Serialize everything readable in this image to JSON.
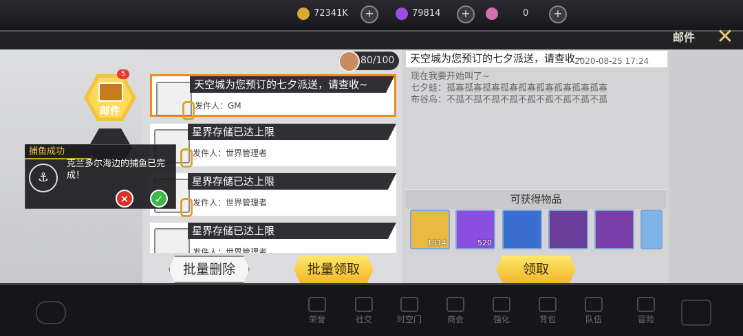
{
  "top_hud": {
    "gold": "72341K",
    "crystal": "79814",
    "gem": "0"
  },
  "header": {
    "title": "邮件",
    "close_icon": "close-x-icon"
  },
  "tabs": [
    {
      "label": "邮件",
      "badge": "5",
      "icon": "envelope-icon"
    },
    {
      "label": "",
      "icon": "chat-icon"
    }
  ],
  "mailbox": {
    "count": "80/100"
  },
  "mails": [
    {
      "title": "天空城为您预订的七夕派送，请查收~",
      "sender": "发件人：GM"
    },
    {
      "title": "星界存储已达上限",
      "sender": "发件人：世界管理者"
    },
    {
      "title": "星界存储已达上限",
      "sender": "发件人：世界管理者"
    },
    {
      "title": "星界存储已达上限",
      "sender": "发件人：世界管理者"
    }
  ],
  "buttons": {
    "batch_delete": "批量删除",
    "batch_claim": "批量领取",
    "claim": "领取"
  },
  "detail": {
    "title": "天空城为您预订的七夕派送，请查收~",
    "date": "2020-08-25 17:24",
    "lines": [
      "现在我要开始叫了~",
      "七夕蛙：孤寡孤寡孤寡孤寡孤寡孤寡孤寡孤寡孤寡",
      "布谷鸟：不孤不孤不孤不孤不孤不孤不孤不孤不孤"
    ]
  },
  "rewards": {
    "title": "可获得物品",
    "items": [
      {
        "icon": "gold-coin-icon",
        "count": "1314",
        "color": "#e8b942"
      },
      {
        "icon": "purple-crystal-icon",
        "count": "520",
        "color": "#8a4fe0"
      },
      {
        "icon": "slime-card-icon",
        "count": "",
        "color": "#3a6fd0"
      },
      {
        "icon": "character-card-icon",
        "count": "",
        "color": "#6b3c9a"
      },
      {
        "icon": "character-card-icon",
        "count": "",
        "color": "#7a3ea8"
      },
      {
        "icon": "card-icon",
        "count": "",
        "color": "#7fb4e8"
      }
    ]
  },
  "notification": {
    "tag": "捕鱼成功",
    "text": "克兰多尔海边的捕鱼已完成！",
    "icon": "fishing-hook-icon"
  },
  "bottom_nav": [
    "荣誉",
    "社交",
    "时空门",
    "商会",
    "强化",
    "背包",
    "队伍",
    "冒险"
  ]
}
